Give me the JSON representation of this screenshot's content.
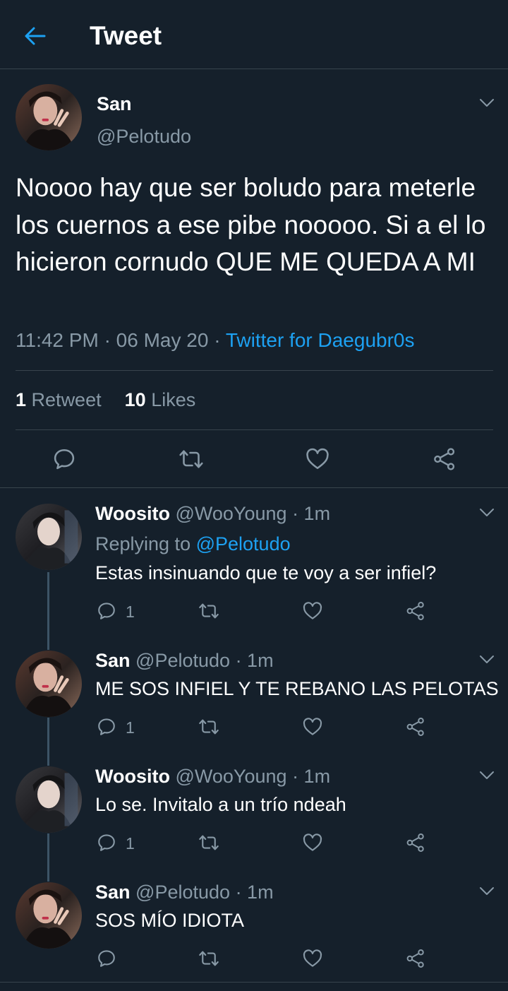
{
  "header": {
    "title": "Tweet"
  },
  "main_tweet": {
    "name": "San",
    "handle": "@Pelotudo",
    "text": "Noooo hay que ser boludo para meterle los cuernos a ese pibe nooooo. Si a el lo hicieron cornudo QUE ME QUEDA A MI",
    "time": "11:42 PM",
    "date": "06 May 20",
    "dot": "·",
    "source": "Twitter for Daegubr0s",
    "retweets_count": "1",
    "retweets_label": "Retweet",
    "likes_count": "10",
    "likes_label": "Likes"
  },
  "replies": [
    {
      "name": "Woosito",
      "handle": "@WooYoung",
      "time": "· 1m",
      "replying_prefix": "Replying to",
      "replying_to": "@Pelotudo",
      "text": "Estas insinuando que te voy a ser infiel?",
      "reply_count": "1"
    },
    {
      "name": "San",
      "handle": "@Pelotudo",
      "time": "· 1m",
      "text": "ME SOS INFIEL Y TE REBANO LAS PELOTAS",
      "reply_count": "1"
    },
    {
      "name": "Woosito",
      "handle": "@WooYoung",
      "time": "· 1m",
      "text": "Lo se. Invitalo a un trío ndeah",
      "reply_count": "1"
    },
    {
      "name": "San",
      "handle": "@Pelotudo",
      "time": "· 1m",
      "text": "SOS MÍO IDIOTA",
      "reply_count": ""
    }
  ],
  "colors": {
    "background": "#15202b",
    "accent": "#1da1f2",
    "muted": "#8899a6",
    "divider": "#38444d"
  },
  "icons": [
    "back-arrow-icon",
    "chevron-down-icon",
    "reply-icon",
    "retweet-icon",
    "like-icon",
    "share-icon"
  ]
}
